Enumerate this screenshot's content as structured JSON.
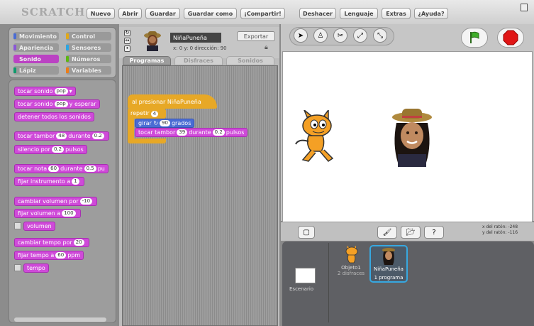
{
  "app": {
    "logo": "SCRATCH"
  },
  "menu": {
    "buttons": [
      "Nuevo",
      "Abrir",
      "Guardar",
      "Guardar como",
      "¡Compartir!",
      "Deshacer",
      "Lenguaje",
      "Extras",
      "¿Ayuda?"
    ]
  },
  "categories": [
    {
      "label": "Movimiento",
      "color": "#4a6cd4"
    },
    {
      "label": "Control",
      "color": "#e1a91a"
    },
    {
      "label": "Apariencia",
      "color": "#8a55d7"
    },
    {
      "label": "Sensores",
      "color": "#2ca5e2"
    },
    {
      "label": "Sonido",
      "color": "#bb42c3",
      "selected": true
    },
    {
      "label": "Números",
      "color": "#5cb712"
    },
    {
      "label": "Lápiz",
      "color": "#0e9a6c"
    },
    {
      "label": "Variables",
      "color": "#ee7d16"
    }
  ],
  "palette_blocks": {
    "play_sound": {
      "prefix": "tocar sonido",
      "arg": "pop"
    },
    "play_sound_wait": {
      "prefix": "tocar sonido",
      "arg": "pop",
      "suffix": "y esperar"
    },
    "stop_all": {
      "text": "detener todos los sonidos"
    },
    "play_drum": {
      "prefix": "tocar tambor",
      "arg": "48",
      "mid": "durante",
      "arg2": "0.2"
    },
    "rest": {
      "prefix": "silencio por",
      "arg": "0.2",
      "suffix": "pulsos"
    },
    "play_note": {
      "prefix": "tocar nota",
      "arg": "60",
      "mid": "durante",
      "arg2": "0.5",
      "suffix": "pu"
    },
    "set_instrument": {
      "prefix": "fijar instrumento a",
      "arg": "1"
    },
    "change_volume": {
      "prefix": "cambiar volumen por",
      "arg": "-10"
    },
    "set_volume": {
      "prefix": "fijar volumen a",
      "arg": "100"
    },
    "volume": {
      "text": "volumen"
    },
    "change_tempo": {
      "prefix": "cambiar tempo por",
      "arg": "20"
    },
    "set_tempo": {
      "prefix": "fijar tempo a",
      "arg": "60",
      "suffix": "ppm"
    },
    "tempo": {
      "text": "tempo"
    }
  },
  "sprite": {
    "name": "NiñaPuneña",
    "export_label": "Exportar",
    "coords": "x: 0   y: 0   dirección: 90"
  },
  "tabs": [
    "Programas",
    "Disfraces",
    "Sonidos"
  ],
  "script": {
    "hat": "al presionar NiñaPuneña",
    "repeat_label": "repetir",
    "repeat_count": "4",
    "turn_prefix": "girar",
    "turn_value": "90",
    "turn_suffix": "grados",
    "drum_prefix": "tocar tambor",
    "drum_value": "39",
    "drum_mid": "durante",
    "drum_beats": "0.2",
    "drum_suffix": "pulsos"
  },
  "mouse": {
    "x_label": "x del ratón: -248",
    "y_label": "y del ratón: -116"
  },
  "sprites_panel": {
    "stage_label": "Escenario",
    "sprite1_name": "Objeto1",
    "sprite1_sub": "2 disfraces",
    "sprite2_name": "NiñaPuneña",
    "sprite2_sub": "1 programa"
  }
}
